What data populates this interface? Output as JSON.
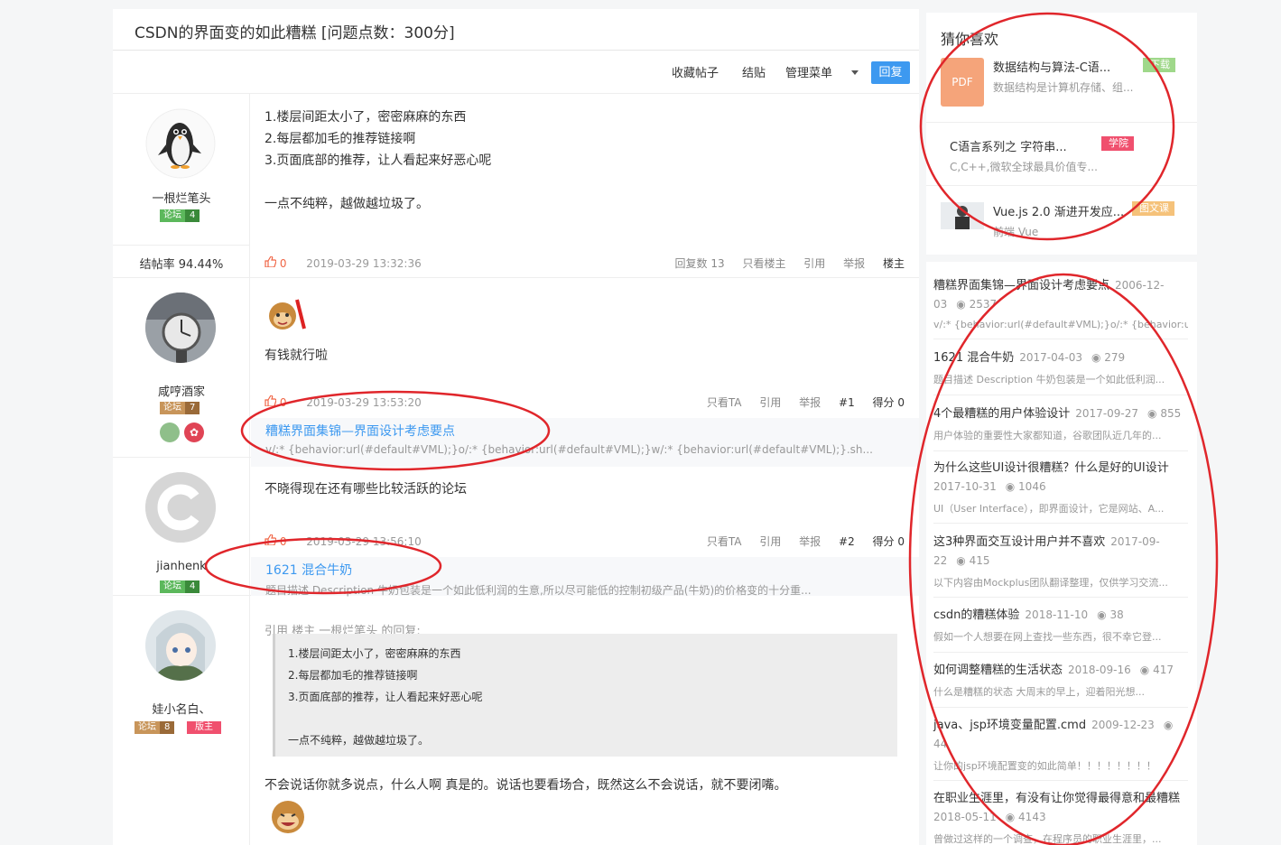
{
  "thread": {
    "title": "CSDN的界面变的如此糟糕 [问题点数：300分]",
    "toolbar": {
      "favorite": "收藏帖子",
      "close": "结贴",
      "manage": "管理菜单",
      "reply": "回复"
    }
  },
  "posts": [
    {
      "user": "一根烂笔头",
      "forum_badge": "论坛",
      "level": "4",
      "stat": "结帖率 94.44%",
      "lines": [
        "1.楼层间距太小了，密密麻麻的东西",
        "2.每层都加毛的推荐链接啊",
        "3.页面底部的推荐，让人看起来好恶心呢",
        "",
        "一点不纯粹，越做越垃圾了。"
      ],
      "likes": "0",
      "time": "2019-03-29 13:32:36",
      "actions": {
        "replies": "回复数",
        "reply_count": "13",
        "only_op": "只看楼主",
        "quote": "引用",
        "report": "举报",
        "role": "楼主"
      }
    },
    {
      "user": "咸哼酒家",
      "forum_badge": "论坛",
      "level": "7",
      "text": "有钱就行啦",
      "likes": "0",
      "time": "2019-03-29 13:53:20",
      "actions": {
        "only_ta": "只看TA",
        "quote": "引用",
        "report": "举报",
        "floor": "#1",
        "score": "得分 0"
      },
      "rec_title": "糟糕界面集锦—界面设计考虑要点",
      "rec_desc": "v/:* {behavior:url(#default#VML);}o/:* {behavior:url(#default#VML);}w/:* {behavior:url(#default#VML);}.sh..."
    },
    {
      "user": "jianhenk",
      "forum_badge": "论坛",
      "level": "4",
      "text": "不晓得现在还有哪些比较活跃的论坛",
      "likes": "0",
      "time": "2019-03-29 13:56:10",
      "actions": {
        "only_ta": "只看TA",
        "quote": "引用",
        "report": "举报",
        "floor": "#2",
        "score": "得分 0"
      },
      "rec_title": "1621 混合牛奶",
      "rec_desc": "题目描述 Description 牛奶包装是一个如此低利润的生意,所以尽可能低的控制初级产品(牛奶)的价格变的十分重..."
    },
    {
      "user": "娃小名白、",
      "forum_badge": "论坛",
      "level": "8",
      "mod_badge": "版主",
      "quote_header": "引用 楼主 一根烂笔头 的回复:",
      "quote_lines": [
        "1.楼层间距太小了，密密麻麻的东西",
        "2.每层都加毛的推荐链接啊",
        "3.页面底部的推荐，让人看起来好恶心呢",
        "",
        "一点不纯粹，越做越垃圾了。"
      ],
      "text": "不会说话你就多说点，什么人啊  真是的。说话也要看场合，既然这么不会说话，就不要闭嘴。"
    }
  ],
  "sidebar": {
    "heading": "猜你喜欢",
    "recommend": [
      {
        "title": "数据结构与算法-C语...",
        "desc": "数据结构是计算机存储、组...",
        "tag": "下载",
        "icon_text": "PDF"
      },
      {
        "title": "C语言系列之 字符串...",
        "desc": "C,C++,微软全球最具价值专...",
        "tag": "学院"
      },
      {
        "title": "Vue.js 2.0 渐进开发应...",
        "desc": "前端 Vue",
        "tag": "图文课"
      }
    ],
    "blogs": [
      {
        "title": "糟糕界面集锦—界面设计考虑要点",
        "date": "2006-12-03",
        "views": "2537",
        "desc": "v/:* {behavior:url(#default#VML);}o/:* {behavior:url(#default#VML);}"
      },
      {
        "title": "1621 混合牛奶",
        "date": "2017-04-03",
        "views": "279",
        "desc": "题目描述 Description 牛奶包装是一个如此低利润..."
      },
      {
        "title": "4个最糟糕的用户体验设计",
        "date": "2017-09-27",
        "views": "855",
        "desc": "用户体验的重要性大家都知道，谷歌团队近几年的..."
      },
      {
        "title": "为什么这些UI设计很糟糕？什么是好的UI设计",
        "date": "2017-10-31",
        "views": "1046",
        "desc": "UI（User Interface），即界面设计，它是网站、A..."
      },
      {
        "title": "这3种界面交互设计用户并不喜欢",
        "date": "2017-09-22",
        "views": "415",
        "desc": "以下内容由Mockplus团队翻译整理，仅供学习交流..."
      },
      {
        "title": "csdn的糟糕体验",
        "date": "2018-11-10",
        "views": "38",
        "desc": "假如一个人想要在网上查找一些东西，很不幸它登..."
      },
      {
        "title": "如何调整糟糕的生活状态",
        "date": "2018-09-16",
        "views": "417",
        "desc": "什么是糟糕的状态      大周末的早上，迎着阳光想..."
      },
      {
        "title": "java、jsp环境变量配置.cmd",
        "date": "2009-12-23",
        "views": "44",
        "desc": "让你的jsp环境配置变的如此简单！！！！！！！！"
      },
      {
        "title": "在职业生涯里，有没有让你觉得最得意和最糟糕",
        "date": "2018-05-11",
        "views": "4143",
        "desc": "曾做过这样的一个调查，在程序员的职业生涯里，..."
      }
    ]
  },
  "colors": {
    "accent": "#3d99f0",
    "annotation": "#e0262b",
    "like": "#f06545"
  }
}
